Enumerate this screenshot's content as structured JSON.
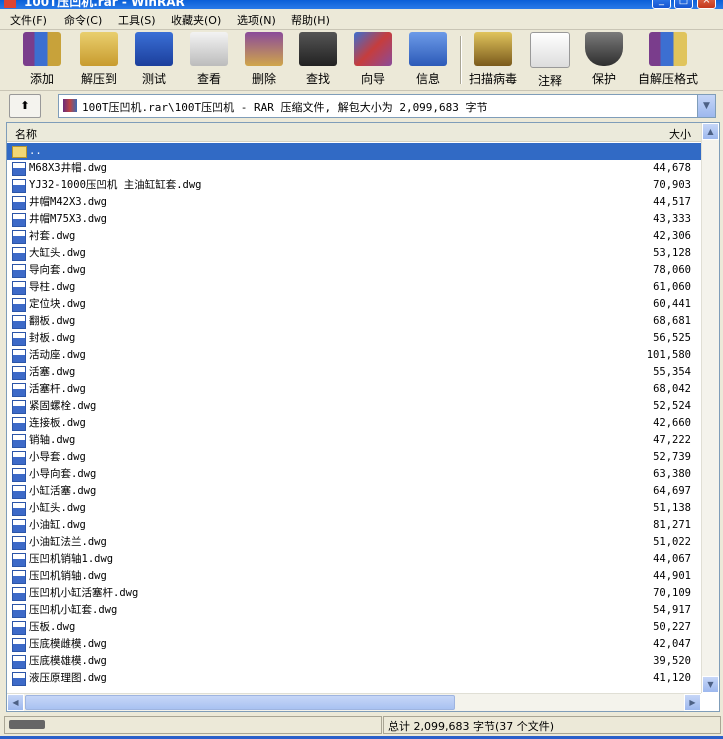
{
  "window": {
    "title": "100T压凹机.rar - WinRAR"
  },
  "menu": [
    "文件(F)",
    "命令(C)",
    "工具(S)",
    "收藏夹(O)",
    "选项(N)",
    "帮助(H)"
  ],
  "toolbar": [
    "添加",
    "解压到",
    "测试",
    "查看",
    "删除",
    "查找",
    "向导",
    "信息",
    "扫描病毒",
    "注释",
    "保护",
    "自解压格式"
  ],
  "address": {
    "text": "100T压凹机.rar\\100T压凹机 - RAR 压缩文件, 解包大小为 2,099,683 字节"
  },
  "columns": {
    "name": "名称",
    "size": "大小"
  },
  "parent_row": "..",
  "files": [
    {
      "name": "M68X3井帽.dwg",
      "size": "44,678"
    },
    {
      "name": "YJ32-1000压凹机 主油缸缸套.dwg",
      "size": "70,903"
    },
    {
      "name": "井帽M42X3.dwg",
      "size": "44,517"
    },
    {
      "name": "井帽M75X3.dwg",
      "size": "43,333"
    },
    {
      "name": "衬套.dwg",
      "size": "42,306"
    },
    {
      "name": "大缸头.dwg",
      "size": "53,128"
    },
    {
      "name": "导向套.dwg",
      "size": "78,060"
    },
    {
      "name": "导柱.dwg",
      "size": "61,060"
    },
    {
      "name": "定位块.dwg",
      "size": "60,441"
    },
    {
      "name": "翻板.dwg",
      "size": "68,681"
    },
    {
      "name": "封板.dwg",
      "size": "56,525"
    },
    {
      "name": "活动座.dwg",
      "size": "101,580"
    },
    {
      "name": "活塞.dwg",
      "size": "55,354"
    },
    {
      "name": "活塞杆.dwg",
      "size": "68,042"
    },
    {
      "name": "紧固螺栓.dwg",
      "size": "52,524"
    },
    {
      "name": "连接板.dwg",
      "size": "42,660"
    },
    {
      "name": "销轴.dwg",
      "size": "47,222"
    },
    {
      "name": "小导套.dwg",
      "size": "52,739"
    },
    {
      "name": "小导向套.dwg",
      "size": "63,380"
    },
    {
      "name": "小缸活塞.dwg",
      "size": "64,697"
    },
    {
      "name": "小缸头.dwg",
      "size": "51,138"
    },
    {
      "name": "小油缸.dwg",
      "size": "81,271"
    },
    {
      "name": "小油缸法兰.dwg",
      "size": "51,022"
    },
    {
      "name": "压凹机销轴1.dwg",
      "size": "44,067"
    },
    {
      "name": "压凹机销轴.dwg",
      "size": "44,901"
    },
    {
      "name": "压凹机小缸活塞杆.dwg",
      "size": "70,109"
    },
    {
      "name": "压凹机小缸套.dwg",
      "size": "54,917"
    },
    {
      "name": "压板.dwg",
      "size": "50,227"
    },
    {
      "name": "压底模雌模.dwg",
      "size": "42,047"
    },
    {
      "name": "压底模雄模.dwg",
      "size": "39,520"
    },
    {
      "name": "液压原理图.dwg",
      "size": "41,120"
    }
  ],
  "status": {
    "summary": "总计 2,099,683 字节(37 个文件)"
  }
}
